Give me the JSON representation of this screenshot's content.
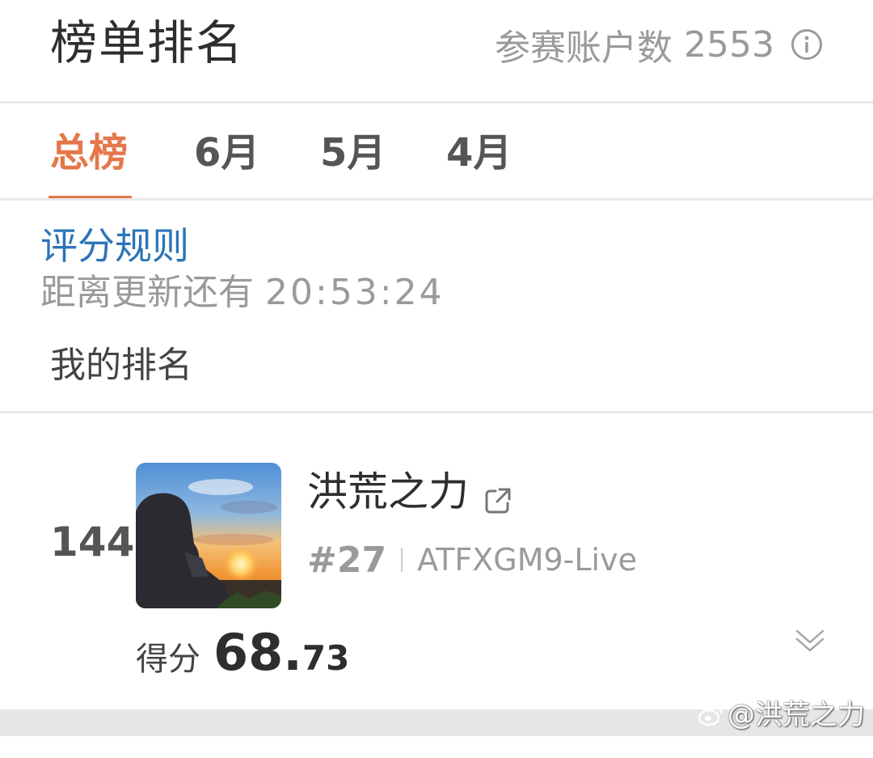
{
  "header": {
    "title": "榜单排名",
    "participants_label": "参赛账户数",
    "participants_count": "2553",
    "info_icon": "info-circle-icon"
  },
  "tabs": [
    {
      "label": "总榜",
      "active": true
    },
    {
      "label": "6月",
      "active": false
    },
    {
      "label": "5月",
      "active": false
    },
    {
      "label": "4月",
      "active": false
    }
  ],
  "rules": {
    "link_label": "评分规则",
    "countdown_label": "距离更新还有",
    "countdown_time": "20:53:24"
  },
  "my_rank": {
    "section_label": "我的排名",
    "rank": "144",
    "name": "洪荒之力",
    "sub_rank": "#27",
    "account": "ATFXGM9-Live",
    "score_label": "得分",
    "score_int": "68.",
    "score_dec": "73"
  },
  "watermark": {
    "text": "@洪荒之力"
  },
  "colors": {
    "accent": "#e5774a",
    "link": "#2b74b8",
    "muted": "#9a9a9a"
  }
}
